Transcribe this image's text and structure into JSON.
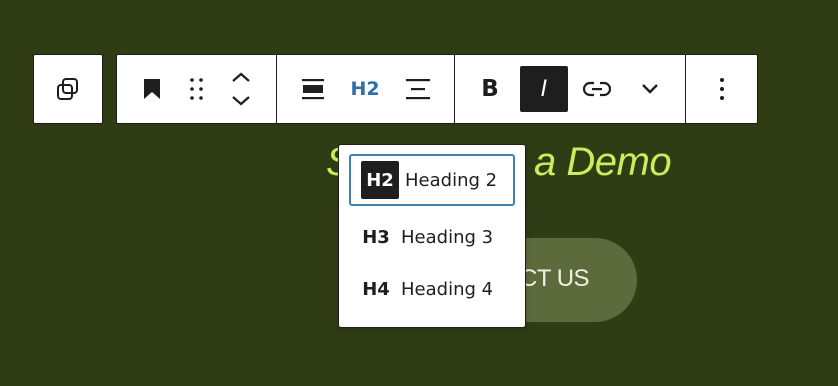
{
  "content": {
    "heading_visible_start": "S",
    "heading_visible_end": "a Demo",
    "cta_visible_label": "CT US"
  },
  "toolbar": {
    "heading_level_label": "H2",
    "bold_label": "B",
    "italic_label": "I",
    "icons": {
      "transform": "duplicate-squares-icon",
      "bookmark": "bookmark-icon",
      "drag": "drag-handle-icon",
      "move": "chevron-up-down-icon",
      "align": "align-wide-icon",
      "text_align": "text-align-icon",
      "link": "link-icon",
      "more_format": "chevron-down-icon",
      "options": "vertical-ellipsis-icon"
    }
  },
  "heading_dropdown": {
    "items": [
      {
        "level": "H2",
        "label": "Heading 2",
        "selected": true
      },
      {
        "level": "H3",
        "label": "Heading 3",
        "selected": false
      },
      {
        "level": "H4",
        "label": "Heading 4",
        "selected": false
      }
    ]
  },
  "colors": {
    "background": "#2f3c14",
    "heading_accent": "#c8ee5c",
    "button_fill": "#5d6a3b",
    "focus_border": "#3e82b4",
    "toolbar_border": "#1e1e1e"
  }
}
